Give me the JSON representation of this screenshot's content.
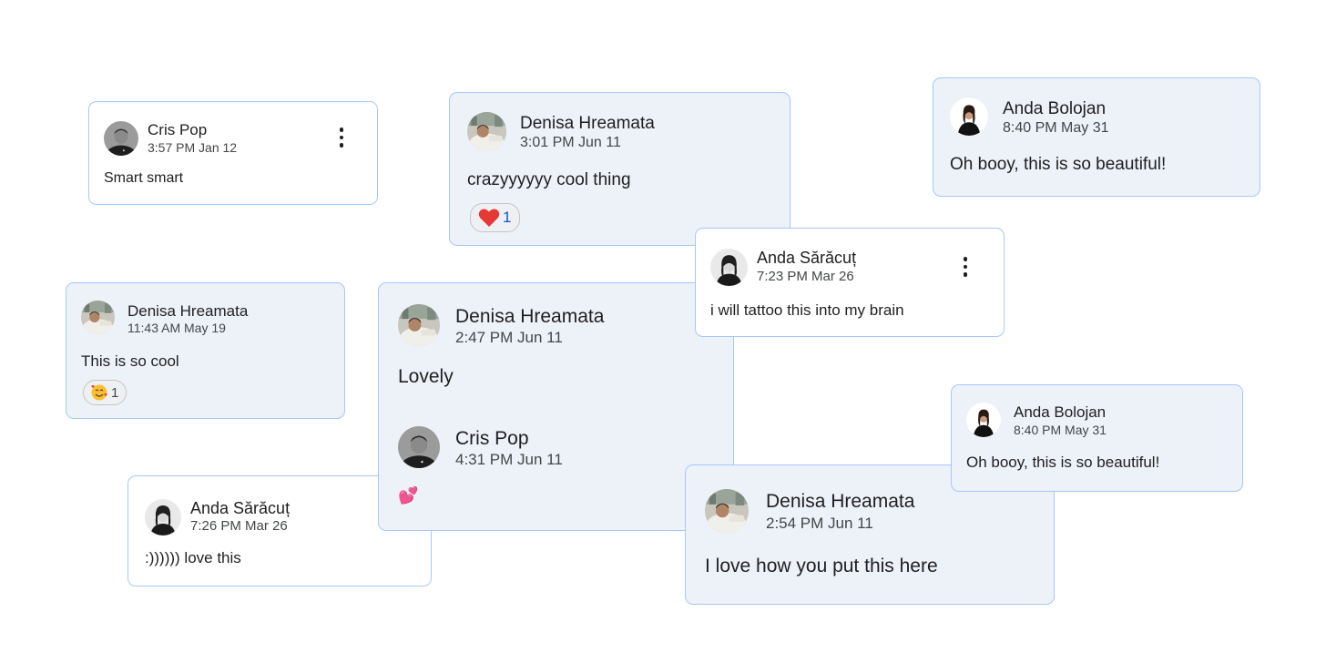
{
  "comments": {
    "c1": {
      "name": "Cris Pop",
      "time": "3:57 PM Jan 12",
      "message": "Smart smart"
    },
    "c2": {
      "name": "Denisa Hreamata",
      "time": "3:01 PM Jun 11",
      "message": "crazyyyyyy cool thing",
      "reaction": {
        "emoji": "heart",
        "count": "1"
      }
    },
    "c3": {
      "name": "Anda Bolojan",
      "time": "8:40 PM May 31",
      "message": "Oh booy, this is so beautiful!"
    },
    "c4": {
      "name": "Anda Sărăcuț",
      "time": "7:23 PM Mar 26",
      "message": "i will tattoo this into my brain"
    },
    "c5": {
      "name": "Denisa Hreamata",
      "time": "11:43 AM May 19",
      "message": "This is so cool",
      "reaction": {
        "emoji": "smiling-face-with-hearts",
        "count": "1"
      }
    },
    "c6": {
      "name": "Denisa Hreamata",
      "time": "2:47 PM Jun 11",
      "message": "Lovely",
      "reply": {
        "name": "Cris Pop",
        "time": "4:31 PM Jun 11",
        "message": "💕"
      }
    },
    "c7": {
      "name": "Anda Bolojan",
      "time": "8:40 PM May 31",
      "message": "Oh booy, this is so beautiful!"
    },
    "c8": {
      "name": "Anda Sărăcuț",
      "time": "7:26 PM Mar 26",
      "message": ":)))))) love this"
    },
    "c9": {
      "name": "Denisa Hreamata",
      "time": "2:54 PM Jun 11",
      "message": "I love how you put this here"
    }
  },
  "colors": {
    "card_border": "#a8c7fa",
    "card_tint": "#edf1f8",
    "heart": "#e53935",
    "count": "#0b57d0"
  }
}
